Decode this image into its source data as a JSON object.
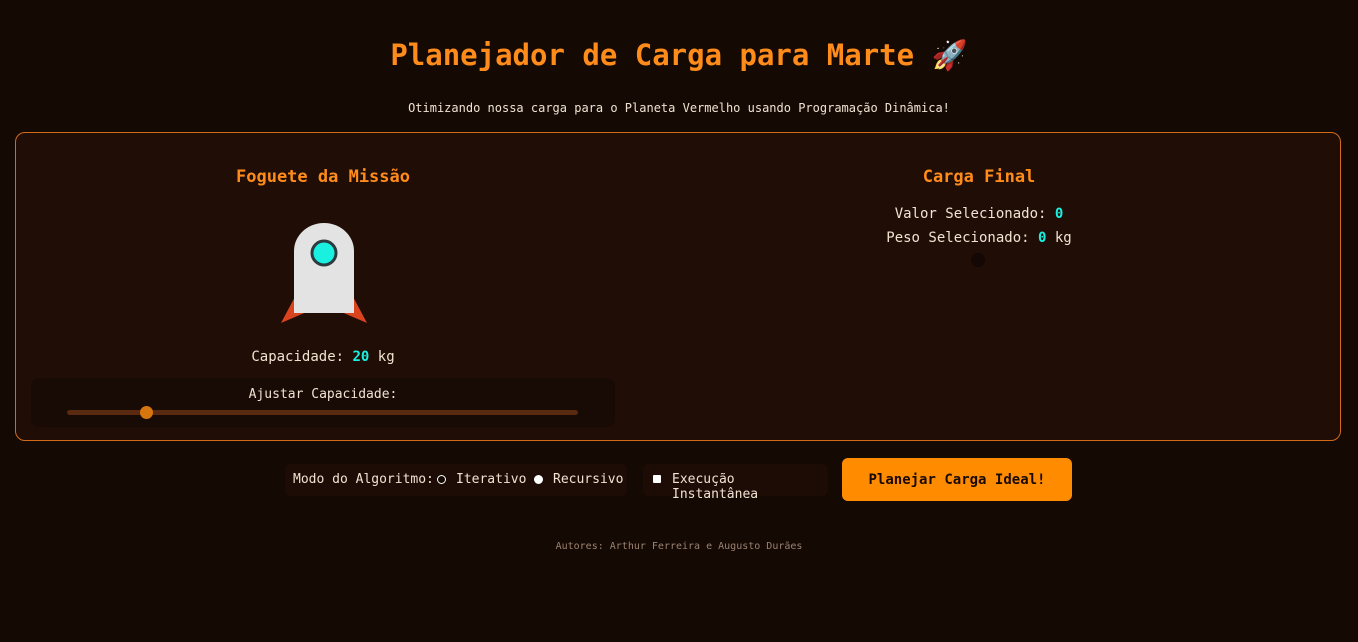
{
  "header": {
    "title": "Planejador de Carga para Marte",
    "title_emoji": "🚀",
    "subtitle": "Otimizando nossa carga para o Planeta Vermelho usando Programação Dinâmica!"
  },
  "mission": {
    "title": "Foguete da Missão",
    "capacity_label": "Capacidade:",
    "capacity_value": "20",
    "capacity_unit": "kg",
    "slider_label": "Ajustar Capacidade:",
    "slider_fraction": 0.155
  },
  "result": {
    "title": "Carga Final",
    "value_label": "Valor Selecionado:",
    "value": "0",
    "weight_label": "Peso Selecionado:",
    "weight": "0",
    "weight_unit": "kg"
  },
  "controls": {
    "mode_label": "Modo do Algoritmo:",
    "option_iterative": "Iterativo",
    "option_recursive": "Recursivo",
    "selected_mode": "Recursivo",
    "instant_label": "Execução Instantânea",
    "instant_checked": false,
    "plan_button": "Planejar Carga Ideal!"
  },
  "footer": {
    "authors": "Autores: Arthur Ferreira e Augusto Durães"
  },
  "colors": {
    "background": "#150904",
    "accent_orange": "#ff8c1a",
    "accent_cyan": "#19f0e0",
    "rocket_body": "#e3e3e3",
    "rocket_fins": "#d9441e"
  },
  "icons": {
    "title_icon": "rocket-emoji",
    "rocket": "rocket-illustration"
  }
}
